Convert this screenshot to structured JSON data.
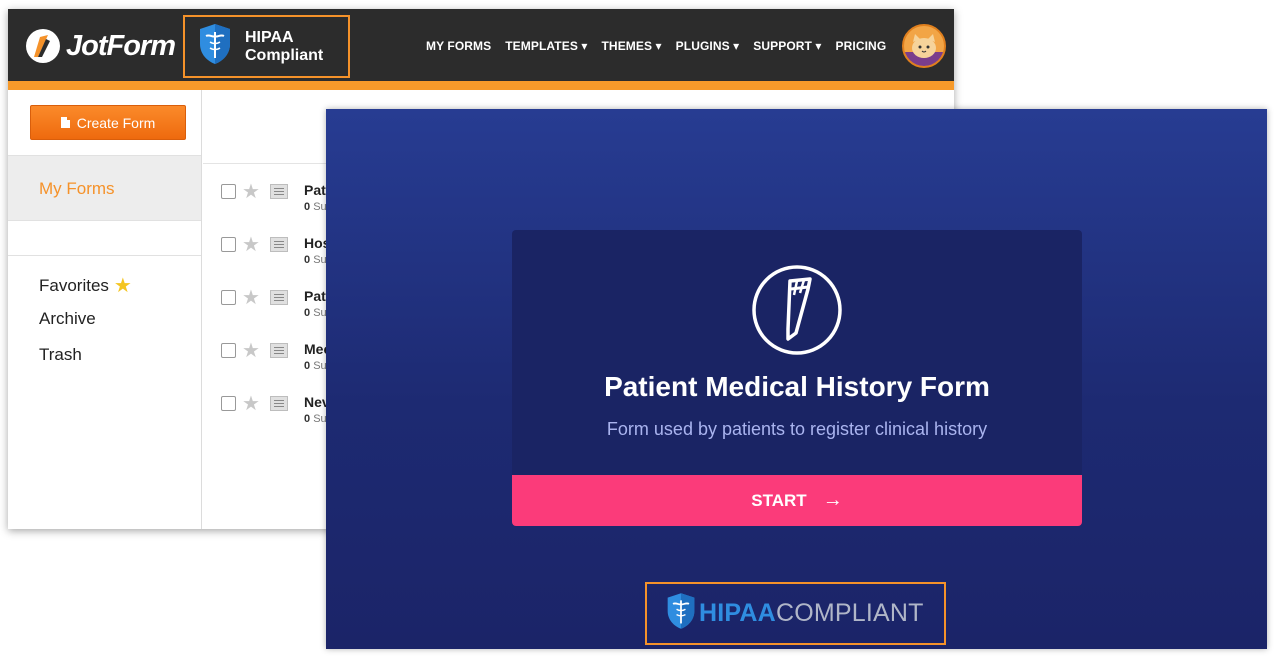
{
  "jotform": {
    "logo_text": "JotForm",
    "hipaa_badge": {
      "line1": "HIPAA",
      "line2": "Compliant"
    },
    "nav": [
      "MY FORMS",
      "TEMPLATES ▾",
      "THEMES ▾",
      "PLUGINS ▾",
      "SUPPORT ▾",
      "PRICING"
    ],
    "create_button": "Create Form",
    "sidebar": {
      "my_forms": "My Forms",
      "favorites": "Favorites",
      "archive": "Archive",
      "trash": "Trash"
    },
    "forms": [
      {
        "title": "Pat",
        "count": "0",
        "sub": "Su"
      },
      {
        "title": "Hos",
        "count": "0",
        "sub": "Su"
      },
      {
        "title": "Pat",
        "count": "0",
        "sub": "Su"
      },
      {
        "title": "Mec",
        "count": "0",
        "sub": "Su"
      },
      {
        "title": "Nev",
        "count": "0",
        "sub": "Su"
      }
    ]
  },
  "form_preview": {
    "title": "Patient Medical History Form",
    "subtitle": "Form used by patients to register clinical history",
    "start_label": "START",
    "hipaa_footer": {
      "part1": "HIPAA",
      "part2": "COMPLIANT"
    }
  },
  "colors": {
    "accent_orange": "#f5922a",
    "start_pink": "#fb3b7a",
    "preview_bg": "#273c92",
    "hipaa_blue": "#2f8de0"
  }
}
